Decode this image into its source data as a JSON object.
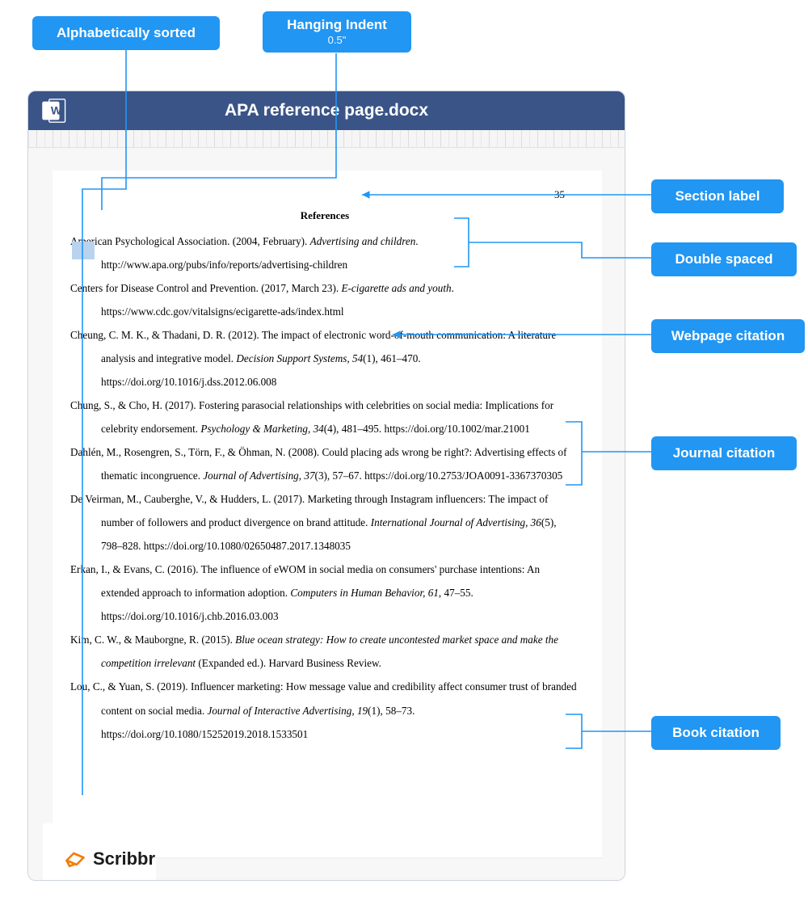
{
  "labels": {
    "alpha": "Alphabetically sorted",
    "hanging": "Hanging Indent",
    "hanging_sub": "0.5\"",
    "section": "Section label",
    "double": "Double spaced",
    "webpage": "Webpage citation",
    "journal": "Journal citation",
    "book": "Book citation"
  },
  "doc": {
    "title": "APA reference page.docx",
    "page_number": "35",
    "heading": "References",
    "refs": [
      {
        "pre": "American Psychological Association. (2004, February). ",
        "title": "Advertising and children",
        "post": ". http://www.apa.org/pubs/info/reports/advertising-children"
      },
      {
        "pre": "Centers for Disease Control and Prevention. (2017, March 23). ",
        "title": "E-cigarette ads and youth",
        "post": ". https://www.cdc.gov/vitalsigns/ecigarette-ads/index.html"
      },
      {
        "pre": "Cheung, C. M. K., & Thadani, D. R. (2012). The impact of electronic word-of-mouth communication: A literature analysis and integrative model. ",
        "title": "Decision Support Systems",
        "vol": ", 54",
        "post": "(1), 461–470. https://doi.org/10.1016/j.dss.2012.06.008"
      },
      {
        "pre": "Chung, S., & Cho, H. (2017). Fostering parasocial relationships with celebrities on social media: Implications for celebrity endorsement. ",
        "title": "Psychology & Marketing",
        "vol": ", 34",
        "post": "(4), 481–495. https://doi.org/10.1002/mar.21001"
      },
      {
        "pre": "Dahlén, M., Rosengren, S., Törn, F., & Öhman, N. (2008). Could placing ads wrong be right?: Advertising effects of thematic incongruence. ",
        "title": "Journal of Advertising",
        "vol": ", 37",
        "post": "(3), 57–67. https://doi.org/10.2753/JOA0091-3367370305"
      },
      {
        "pre": "De Veirman, M., Cauberghe, V., & Hudders, L. (2017). Marketing through Instagram influencers: The impact of number of followers and product divergence on brand attitude. ",
        "title": "International Journal of Advertising",
        "vol": ", 36",
        "post": "(5), 798–828. https://doi.org/10.1080/02650487.2017.1348035"
      },
      {
        "pre": "Erkan, I., & Evans, C. (2016). The influence of eWOM in social media on consumers' purchase intentions: An extended approach to information adoption. ",
        "title": "Computers in Human Behavior",
        "vol": ", 61",
        "post": ", 47–55. https://doi.org/10.1016/j.chb.2016.03.003"
      },
      {
        "pre": "Kim, C. W., & Mauborgne, R. (2015). ",
        "title": "Blue ocean strategy: How to create uncontested market space and make the competition irrelevant",
        "post_no_vol": " (Expanded ed.). Harvard Business Review."
      },
      {
        "pre": "Lou, C., & Yuan, S. (2019). Influencer marketing: How message value and credibility affect consumer trust of branded content on social media. ",
        "title": "Journal of Interactive Advertising",
        "vol": ", 19",
        "post": "(1), 58–73. https://doi.org/10.1080/15252019.2018.1533501"
      }
    ]
  },
  "brand": "Scribbr"
}
